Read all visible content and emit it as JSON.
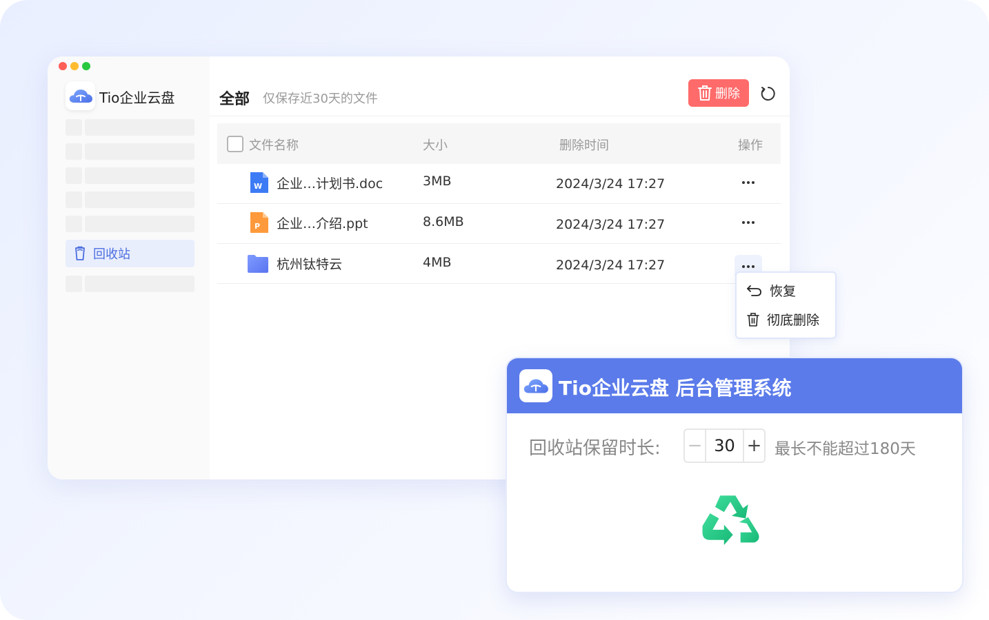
{
  "app": {
    "name": "Tio企业云盘",
    "brand_color": "#5b7bea",
    "logo_icon": "cloud-logo-icon"
  },
  "sidebar": {
    "active_item": {
      "label": "回收站",
      "icon": "trash-can-icon"
    }
  },
  "header": {
    "title": "全部",
    "subtitle": "仅保存近30天的文件",
    "delete_button": "删除",
    "delete_color": "#ff6b6b",
    "refresh_icon": "refresh-icon"
  },
  "table": {
    "columns": [
      "文件名称",
      "大小",
      "删除时间",
      "操作"
    ],
    "rows": [
      {
        "name": "企业…计划书.doc",
        "type": "word-file-icon",
        "size": "3MB",
        "deleted_at": "2024/3/24  17:27"
      },
      {
        "name": "企业…介绍.ppt",
        "type": "ppt-file-icon",
        "size": "8.6MB",
        "deleted_at": "2024/3/24  17:27"
      },
      {
        "name": "杭州钛特云",
        "type": "folder-icon",
        "size": "4MB",
        "deleted_at": "2024/3/24  17:27"
      }
    ]
  },
  "context_menu": {
    "restore": "恢复",
    "delete_permanently": "彻底删除"
  },
  "admin": {
    "title": "Tio企业云盘 后台管理系统",
    "retention_label": "回收站保留时长:",
    "retention_value": "30",
    "minus": "−",
    "plus": "+",
    "retention_note": "最长不能超过180天",
    "recycle_icon": "recycle-icon"
  }
}
